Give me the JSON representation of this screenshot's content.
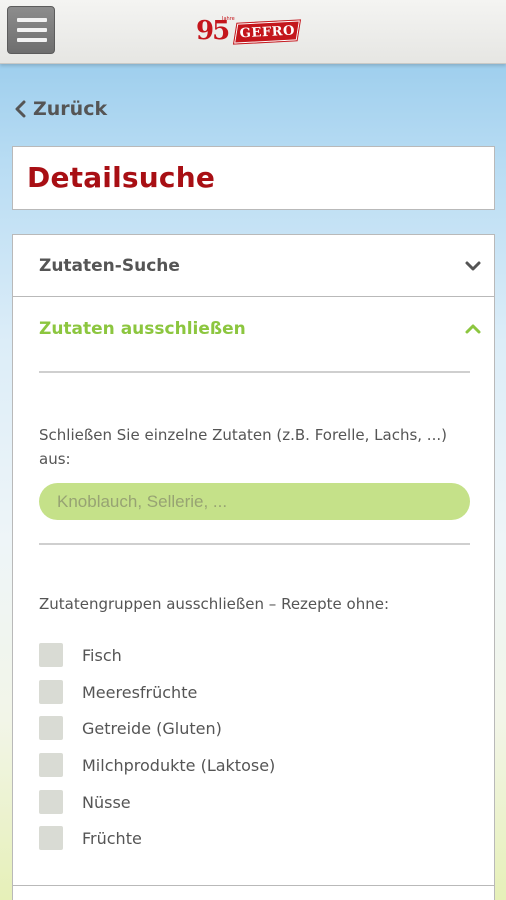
{
  "header": {
    "logo_number": "95",
    "logo_small": "Jahre",
    "logo_brand": "GEFRO"
  },
  "nav": {
    "back_label": "Zurück"
  },
  "page": {
    "title": "Detailsuche"
  },
  "accordion": {
    "section1_label": "Zutaten-Suche",
    "section2_label": "Zutaten ausschließen"
  },
  "exclude": {
    "description": "Schließen Sie einzelne Zutaten (z.B. Forelle, Lachs, ...) aus:",
    "input_placeholder": "Knoblauch, Sellerie, ...",
    "groups_label": "Zutatengruppen ausschließen – Rezepte ohne:",
    "groups": [
      {
        "label": "Fisch",
        "checked": false
      },
      {
        "label": "Meeresfrüchte",
        "checked": false
      },
      {
        "label": "Getreide (Gluten)",
        "checked": false
      },
      {
        "label": "Milchprodukte (Laktose)",
        "checked": false
      },
      {
        "label": "Nüsse",
        "checked": false
      },
      {
        "label": "Früchte",
        "checked": false
      }
    ]
  },
  "colors": {
    "brand_red": "#a80f14",
    "accent_green": "#8cc63f",
    "input_green": "#c5e189"
  },
  "icons": {
    "menu": "hamburger-icon",
    "back": "chevron-left-icon",
    "collapsed": "chevron-down-icon",
    "expanded": "chevron-up-icon"
  }
}
